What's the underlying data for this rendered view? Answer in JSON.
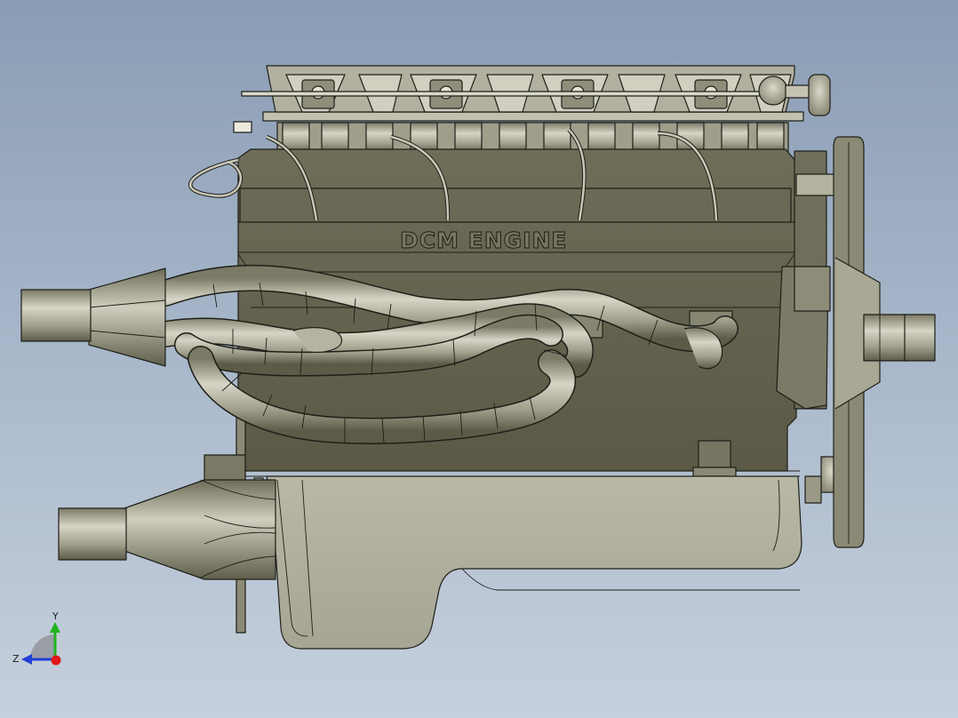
{
  "viewport": {
    "background_top": "#8a9cb4",
    "background_bottom": "#c6d0dc"
  },
  "model": {
    "engraving": "DCM ENGINE",
    "body_color": "#6b6a55",
    "body_light": "#b3b2a0",
    "pipe_color": "#a8a795",
    "edge_color": "#1d1f18"
  },
  "triad": {
    "y_label": "Y",
    "z_label": "Z",
    "y_color": "#1fb41f",
    "z_color": "#1f3fd6",
    "x_color": "#e01818"
  }
}
